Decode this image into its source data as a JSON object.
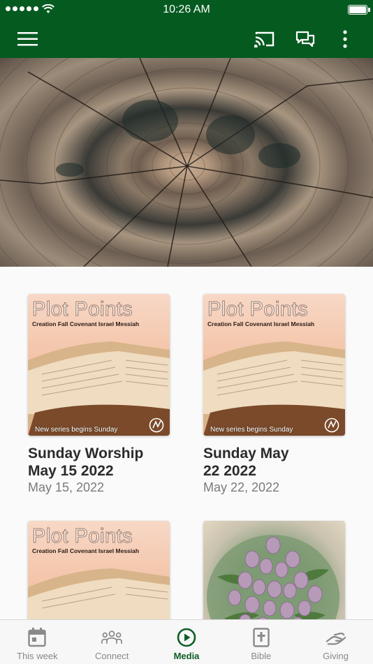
{
  "status_bar": {
    "time": "10:26 AM"
  },
  "app_bar": {
    "menu_icon": "hamburger-menu-icon",
    "cast_icon": "cast-icon",
    "chat_icon": "chat-bubbles-icon",
    "more_icon": "more-vertical-icon"
  },
  "hero": {
    "image": "tree-rings-cross-section"
  },
  "series_art": {
    "title": "Plot Points",
    "subtitle": "Creation  Fall  Covenant  Israel  Messiah",
    "footer": "New series begins Sunday"
  },
  "media_items": [
    {
      "title_line1": "Sunday Worship",
      "title_line2": "May 15 2022",
      "date": "May 15, 2022",
      "art": "plot-points"
    },
    {
      "title_line1": "Sunday May",
      "title_line2": "22 2022",
      "date": "May 22, 2022",
      "art": "plot-points"
    },
    {
      "title_line1": "",
      "title_line2": "",
      "date": "",
      "art": "plot-points"
    },
    {
      "title_line1": "",
      "title_line2": "",
      "date": "",
      "art": "tulips"
    }
  ],
  "tabs": [
    {
      "label": "This week",
      "icon": "calendar-icon",
      "active": false
    },
    {
      "label": "Connect",
      "icon": "people-group-icon",
      "active": false
    },
    {
      "label": "Media",
      "icon": "play-circle-icon",
      "active": true
    },
    {
      "label": "Bible",
      "icon": "bible-cross-icon",
      "active": false
    },
    {
      "label": "Giving",
      "icon": "giving-hand-icon",
      "active": false
    }
  ],
  "colors": {
    "brand_green": "#055a20",
    "active_tab": "#0b5e24",
    "inactive_tab": "#888888"
  }
}
